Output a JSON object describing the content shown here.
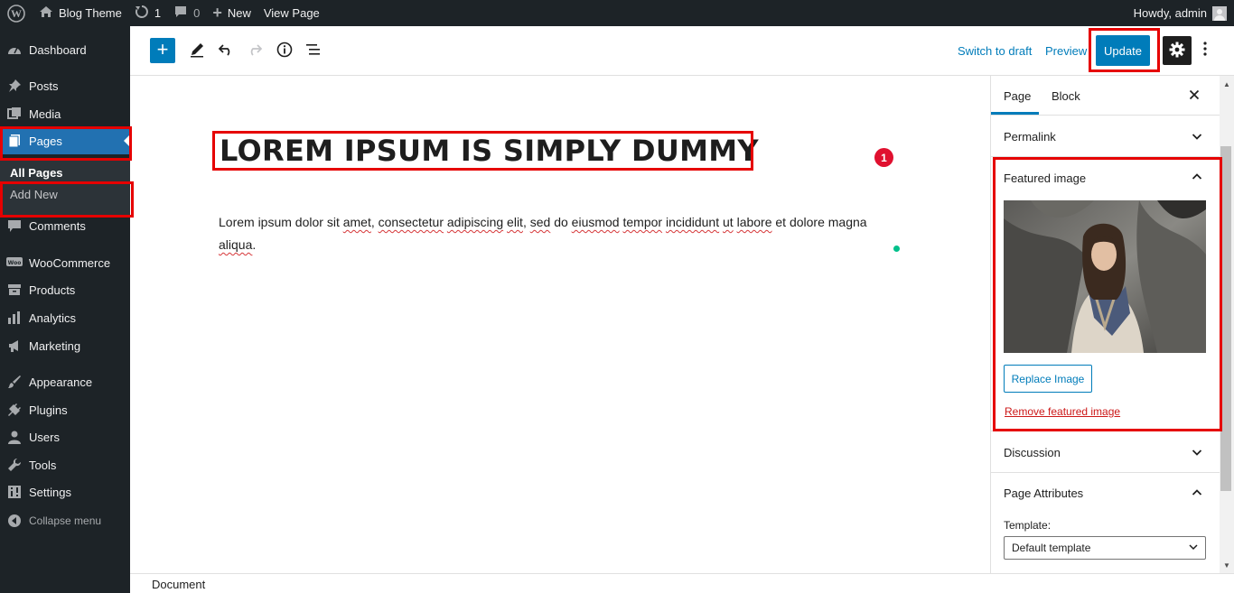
{
  "adminbar": {
    "site_name": "Blog Theme",
    "updates_count": "1",
    "comments_count": "0",
    "new_label": "New",
    "view_label": "View Page",
    "howdy": "Howdy, admin"
  },
  "menu": {
    "dashboard": "Dashboard",
    "posts": "Posts",
    "media": "Media",
    "pages": "Pages",
    "all_pages": "All Pages",
    "add_new": "Add New",
    "comments": "Comments",
    "woocommerce": "WooCommerce",
    "products": "Products",
    "analytics": "Analytics",
    "marketing": "Marketing",
    "appearance": "Appearance",
    "plugins": "Plugins",
    "users": "Users",
    "tools": "Tools",
    "settings": "Settings",
    "collapse": "Collapse menu"
  },
  "toolbar": {
    "switch_to_draft": "Switch to draft",
    "preview": "Preview",
    "update": "Update"
  },
  "content": {
    "title": "LOREM IPSUM IS SIMPLY DUMMY",
    "badge": "1",
    "p_words": [
      "Lorem ipsum dolor sit ",
      "amet",
      ", ",
      "consectetur",
      " ",
      "adipiscing",
      " ",
      "elit",
      ", ",
      "sed",
      " do ",
      "eiusmod",
      " ",
      "tempor",
      " ",
      "incididunt",
      " ",
      "ut",
      " ",
      "labore",
      " et dolore magna ",
      "aliqua",
      "."
    ]
  },
  "sidebar": {
    "tab_page": "Page",
    "tab_block": "Block",
    "permalink": "Permalink",
    "featured_image": "Featured image",
    "replace_image": "Replace Image",
    "remove_image": "Remove featured image",
    "discussion": "Discussion",
    "page_attributes": "Page Attributes",
    "template_label": "Template:",
    "template_value": "Default template"
  },
  "footer": {
    "breadcrumb": "Document"
  },
  "colors": {
    "admin_dark": "#1d2327",
    "wp_blue": "#2271b1",
    "editor_blue": "#007cba",
    "highlight_red": "#e60000"
  }
}
